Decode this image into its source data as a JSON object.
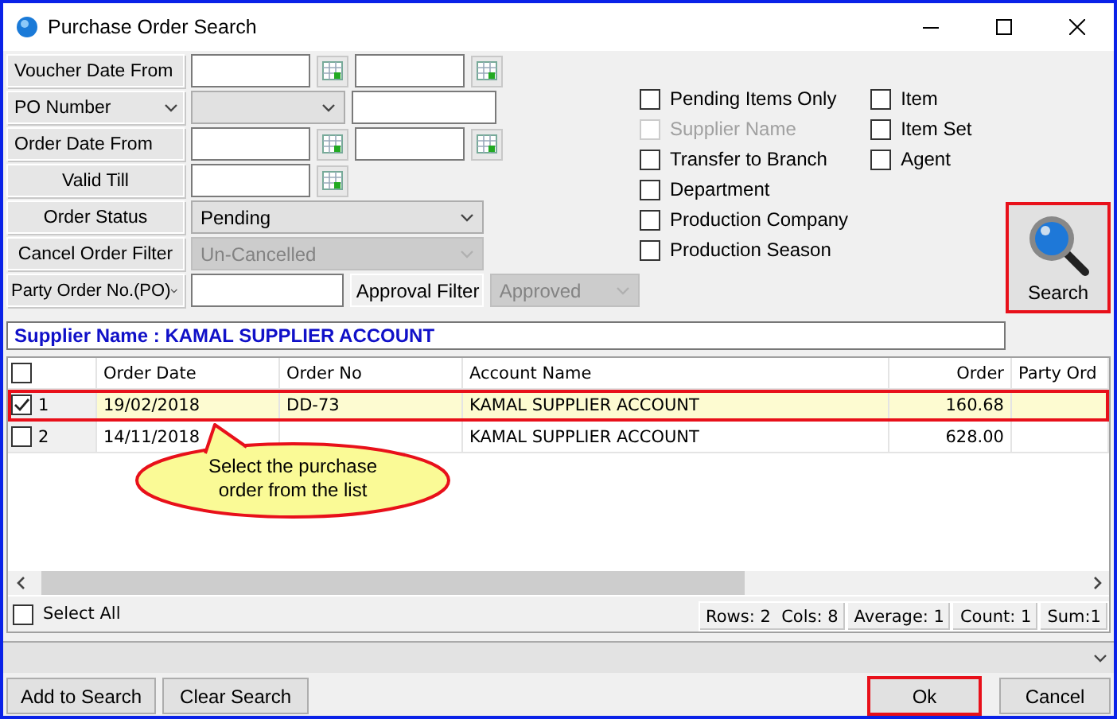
{
  "window": {
    "title": "Purchase Order Search"
  },
  "filters": [
    {
      "kind": "date-range",
      "label": "Voucher Date From"
    },
    {
      "kind": "po-number",
      "label": "PO Number"
    },
    {
      "kind": "date-range",
      "label": "Order Date From"
    },
    {
      "kind": "date",
      "label": "Valid Till"
    },
    {
      "kind": "select",
      "label": "Order Status",
      "value": "Pending",
      "disabled": false
    },
    {
      "kind": "select",
      "label": "Cancel Order Filter",
      "value": "Un-Cancelled",
      "disabled": true
    },
    {
      "kind": "party",
      "label": "Party Order No.(PO)",
      "approval_label": "Approval Filter",
      "approval_value": "Approved",
      "approval_disabled": true
    }
  ],
  "options_left": [
    {
      "label": "Pending Items Only",
      "checked": false,
      "disabled": false
    },
    {
      "label": "Supplier Name",
      "checked": false,
      "disabled": true
    },
    {
      "label": "Transfer to Branch",
      "checked": false,
      "disabled": false
    },
    {
      "label": "Department",
      "checked": false,
      "disabled": false
    },
    {
      "label": "Production Company",
      "checked": false,
      "disabled": false
    },
    {
      "label": "Production Season",
      "checked": false,
      "disabled": false
    }
  ],
  "options_right": [
    {
      "label": "Item",
      "checked": false,
      "disabled": false
    },
    {
      "label": "Item Set",
      "checked": false,
      "disabled": false
    },
    {
      "label": "Agent",
      "checked": false,
      "disabled": false
    }
  ],
  "search_button": {
    "label": "Search",
    "highlighted": true
  },
  "supplier_banner": "Supplier Name : KAMAL SUPPLIER ACCOUNT",
  "table": {
    "header_checked": false,
    "columns": [
      "Order Date",
      "Order No",
      "Account Name",
      "Order",
      "Party Ord"
    ],
    "rows": [
      {
        "number": "1",
        "checked": true,
        "selected": true,
        "highlighted": true,
        "order_date": "19/02/2018",
        "order_no": "DD-73",
        "account": "KAMAL SUPPLIER ACCOUNT",
        "amount": "160.68"
      },
      {
        "number": "2",
        "checked": false,
        "selected": false,
        "highlighted": false,
        "order_date": "14/11/2018",
        "account": "KAMAL SUPPLIER ACCOUNT",
        "amount": "628.00"
      }
    ]
  },
  "callout": "Select the purchase order from the list",
  "select_all": {
    "label": "Select All",
    "checked": false
  },
  "stats": [
    "Rows: 2  Cols: 8",
    "Average: 1",
    "Count: 1",
    "Sum:1"
  ],
  "footer_left": [
    "Add to Search",
    "Clear Search"
  ],
  "footer_right": [
    {
      "label": "Ok",
      "highlighted": true
    },
    {
      "label": "Cancel",
      "highlighted": false
    }
  ]
}
